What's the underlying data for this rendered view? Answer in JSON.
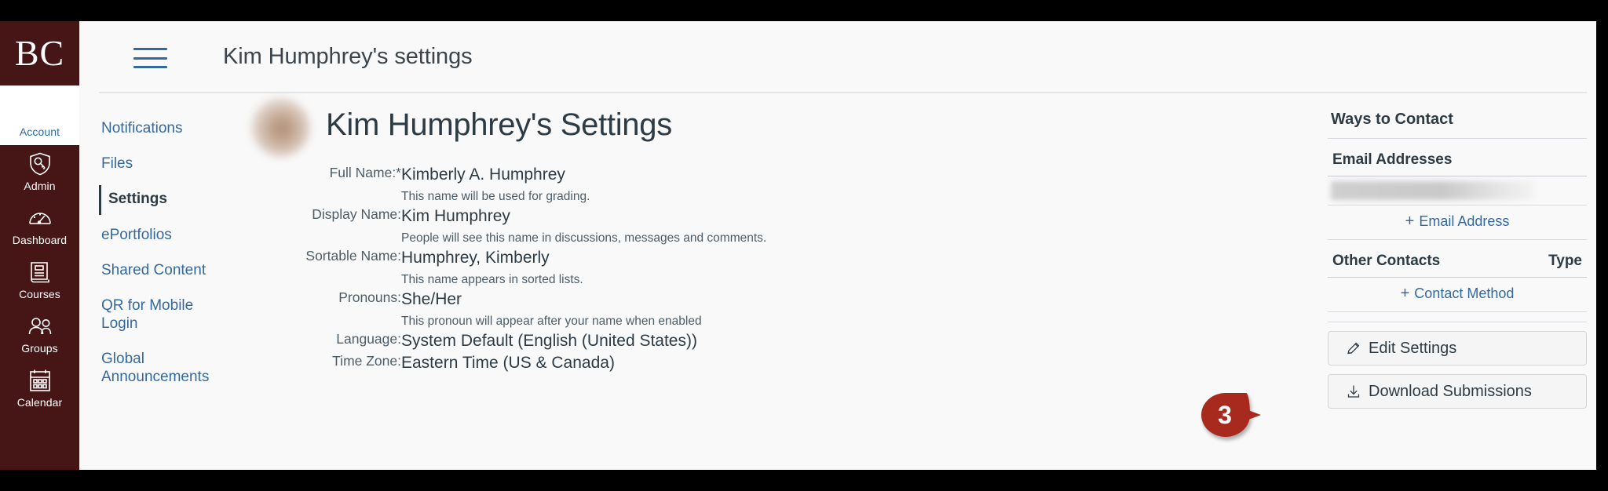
{
  "brand": {
    "logo_text": "BC",
    "primary_color": "#461616",
    "link_color": "#34699e",
    "text_color": "#2d3b45",
    "callout_color": "#a82a1e"
  },
  "global_nav": {
    "items": [
      {
        "label": "Account",
        "icon": "user-avatar-icon",
        "active": true
      },
      {
        "label": "Admin",
        "icon": "shield-key-icon",
        "active": false
      },
      {
        "label": "Dashboard",
        "icon": "dashboard-gauge-icon",
        "active": false
      },
      {
        "label": "Courses",
        "icon": "book-icon",
        "active": false
      },
      {
        "label": "Groups",
        "icon": "people-group-icon",
        "active": false
      },
      {
        "label": "Calendar",
        "icon": "calendar-icon",
        "active": false
      }
    ]
  },
  "header": {
    "menu_icon": "hamburger-icon",
    "title": "Kim Humphrey's settings"
  },
  "section_nav": {
    "items": [
      {
        "label": "Notifications",
        "active": false
      },
      {
        "label": "Files",
        "active": false
      },
      {
        "label": "Settings",
        "active": true
      },
      {
        "label": "ePortfolios",
        "active": false
      },
      {
        "label": "Shared Content",
        "active": false
      },
      {
        "label": "QR for Mobile Login",
        "active": false
      },
      {
        "label": "Global Announcements",
        "active": false
      }
    ]
  },
  "main": {
    "avatar": "profile-avatar-blurred",
    "title": "Kim Humphrey's Settings",
    "fields": [
      {
        "label": "Full Name:*",
        "value": "Kimberly A. Humphrey",
        "hint": "This name will be used for grading."
      },
      {
        "label": "Display Name:",
        "value": "Kim Humphrey",
        "hint": "People will see this name in discussions, messages and comments."
      },
      {
        "label": "Sortable Name:",
        "value": "Humphrey, Kimberly",
        "hint": "This name appears in sorted lists."
      },
      {
        "label": "Pronouns:",
        "value": "She/Her",
        "hint": "This pronoun will appear after your name when enabled"
      },
      {
        "label": "Language:",
        "value": "System Default (English (United States))",
        "hint": ""
      },
      {
        "label": "Time Zone:",
        "value": "Eastern Time (US & Canada)",
        "hint": ""
      }
    ]
  },
  "right_sidebar": {
    "heading": "Ways to Contact",
    "email_section": {
      "heading": "Email Addresses",
      "rows": [
        {
          "value": "",
          "redacted": true
        }
      ],
      "add_label": "Email Address",
      "add_icon": "plus-icon"
    },
    "other_contacts_section": {
      "heading": "Other Contacts",
      "type_heading": "Type",
      "add_label": "Contact Method",
      "add_icon": "plus-icon"
    },
    "buttons": [
      {
        "label": "Edit Settings",
        "icon": "pencil-icon"
      },
      {
        "label": "Download Submissions",
        "icon": "download-icon"
      }
    ]
  },
  "callout": {
    "number": "3",
    "target": "Edit Settings"
  }
}
